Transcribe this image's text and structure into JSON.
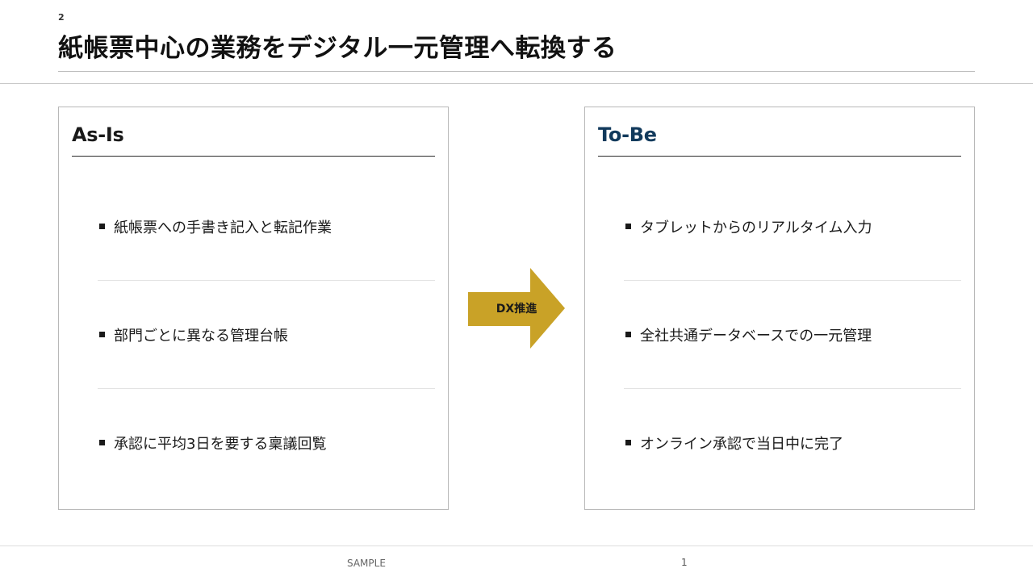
{
  "slide": {
    "number_top": "2",
    "title": "紙帳票中心の業務をデジタル一元管理へ転換する"
  },
  "as_is": {
    "heading": "As-Is",
    "items": [
      "紙帳票への手書き記入と転記作業",
      "部門ごとに異なる管理台帳",
      "承認に平均3日を要する稟議回覧"
    ]
  },
  "to_be": {
    "heading": "To-Be",
    "items": [
      "タブレットからのリアルタイム入力",
      "全社共通データベースでの一元管理",
      "オンライン承認で当日中に完了"
    ]
  },
  "arrow": {
    "label": "DX推進",
    "color": "#c9a227"
  },
  "footer": {
    "label": "SAMPLE",
    "page": "1"
  },
  "colors": {
    "to_be_heading": "#123a5c",
    "accent": "#c9a227"
  }
}
